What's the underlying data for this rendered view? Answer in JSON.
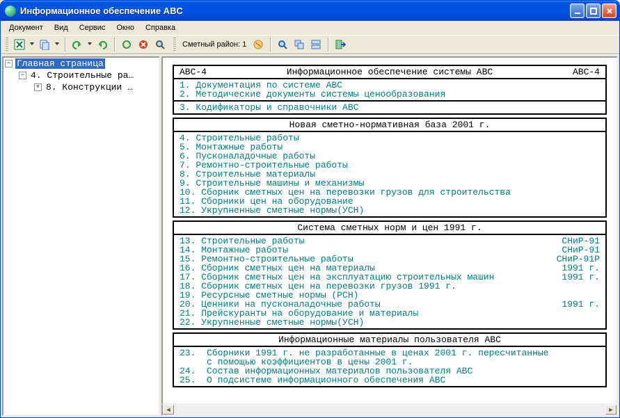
{
  "window": {
    "title": "Информационное обеспечение ABC"
  },
  "menu": {
    "items": [
      "Документ",
      "Вид",
      "Сервис",
      "Окно",
      "Справка"
    ]
  },
  "toolbar": {
    "region_label": "Сметный район: 1"
  },
  "tree": {
    "root": "Главная страница",
    "child1": "4. Строительные ра…",
    "child2": "8. Конструкции …"
  },
  "header": {
    "left": "ABC-4",
    "center": "Информационное обеспечение системы ABC",
    "right": "ABC-4"
  },
  "block1": {
    "l1": "1. Документация по системе ABC",
    "l2": "2. Методические документы системы ценообразования",
    "l3": "3. Кодификаторы и справочники ABC"
  },
  "block2": {
    "title": "Новая сметно-нормативная база 2001 г.",
    "items": {
      "i4": "4. Строительные работы",
      "i5": "5. Монтажные работы",
      "i6": "6. Пусконаладочные работы",
      "i7": "7. Ремонтно-строительные работы",
      "i8": "8. Строительные материалы",
      "i9": "9. Строительные машины и механизмы",
      "i10": "10. Сборник сметных цен на перевозки грузов для строительства",
      "i11": "11. Сборники цен на оборудование",
      "i12": "12. Укрупненные сметные нормы(УСН)"
    }
  },
  "block3": {
    "title": "Система сметных норм и цен 1991 г.",
    "items": {
      "i13": {
        "t": "13. Строительные работы",
        "r": "СНиР-91"
      },
      "i14": {
        "t": "14. Монтажные работы",
        "r": "СНиР-91"
      },
      "i15": {
        "t": "15. Ремонтно-строительные работы",
        "r": "СНиР-91Р"
      },
      "i16": {
        "t": "16. Сборник сметных цен на материалы",
        "r": "1991 г."
      },
      "i17": {
        "t": "17. Сборник сметных цен на эксплуатацию строительных машин",
        "r": "1991 г."
      },
      "i18": {
        "t": "18. Сборник сметных цен на перевозки грузов 1991 г.",
        "r": ""
      },
      "i19": {
        "t": "19. Ресурсные сметные нормы (РСН)",
        "r": ""
      },
      "i20": {
        "t": "20. Ценники на пусконаладочные работы",
        "r": "1991 г."
      },
      "i21": {
        "t": "21. Прейскуранты на оборудование и материалы",
        "r": ""
      },
      "i22": {
        "t": "22. Укрупненные сметные нормы(УСН)",
        "r": ""
      }
    }
  },
  "block4": {
    "title": "Информационные материалы пользователя ABC",
    "items": {
      "i23": "23.  Сборники 1991 г. не разработанные в ценах 2001 г. пересчитанные\n     с помощью коэффициентов в цены 2001 г.",
      "i24": "24.  Состав информационных материалов пользователя ABC",
      "i25": "25.  О подсистеме информационного обеспечения ABC"
    }
  }
}
